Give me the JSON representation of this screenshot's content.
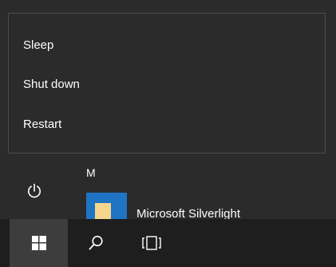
{
  "power_menu": {
    "items": [
      {
        "label": "Sleep"
      },
      {
        "label": "Shut down"
      },
      {
        "label": "Restart"
      }
    ]
  },
  "start_menu": {
    "section_letter": "M",
    "apps": [
      {
        "label": "Microsoft Silverlight",
        "icon": "silverlight-app-icon"
      }
    ],
    "power_icon": "power-icon"
  },
  "taskbar": {
    "start_icon": "windows-logo-icon",
    "search_icon": "search-icon",
    "task_view_icon": "task-view-icon"
  },
  "colors": {
    "menu_background": "#2b2b2b",
    "flyout_border": "#4d4d4d",
    "taskbar_background": "#1e1e1e",
    "start_button_active": "#3d3d3d",
    "text": "#ffffff",
    "app_tile": "#1f74c4"
  }
}
